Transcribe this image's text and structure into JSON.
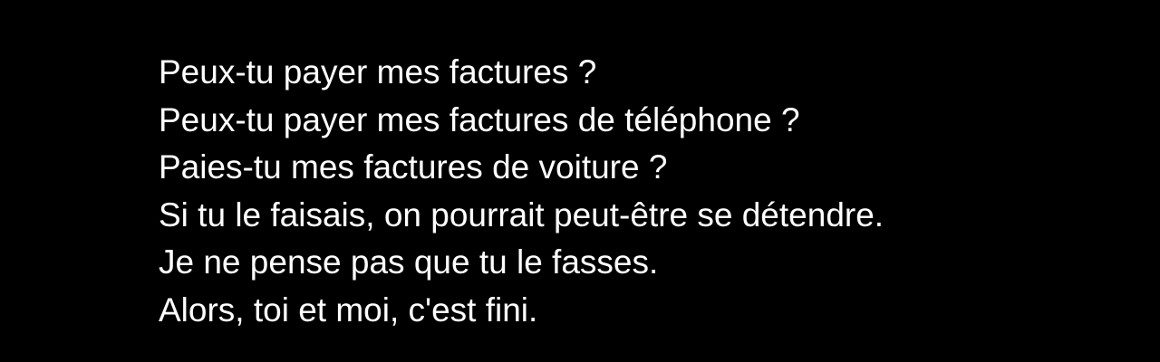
{
  "lyrics": {
    "lines": [
      "Peux-tu payer mes factures ?",
      "Peux-tu payer mes factures de téléphone ?",
      "Paies-tu mes factures de voiture ?",
      "Si tu le faisais, on pourrait peut-être se détendre.",
      "Je ne pense pas que tu le fasses.",
      "Alors, toi et moi, c'est fini."
    ]
  },
  "colors": {
    "background": "#000000",
    "text": "#ffffff"
  }
}
